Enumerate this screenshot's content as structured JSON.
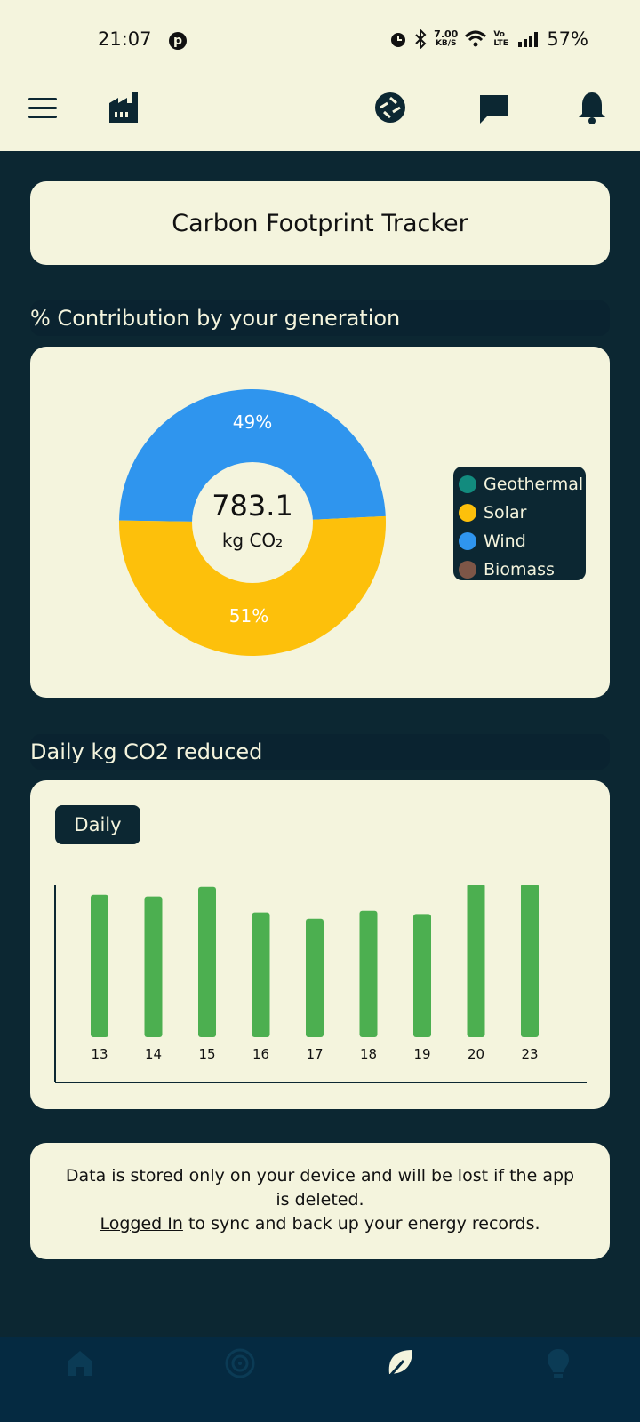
{
  "status_bar": {
    "time": "21:07",
    "pinterest_icon": "pinterest-icon",
    "speed_value": "7.00",
    "speed_unit": "KB/S",
    "volte": "Vo LTE",
    "battery": "57%"
  },
  "app_bar": {
    "icons": [
      "menu-icon",
      "factory-icon",
      "camera-shutter-icon",
      "chat-icon",
      "bell-icon"
    ]
  },
  "title": "Carbon Footprint Tracker",
  "contribution": {
    "heading": "% Contribution by your generation",
    "total_value": "783.1",
    "total_unit": "kg CO₂",
    "slice_labels": {
      "wind": "49%",
      "solar": "51%"
    },
    "legend": [
      {
        "label": "Geothermal",
        "color": "#128b7e"
      },
      {
        "label": "Solar",
        "color": "#fdc00b"
      },
      {
        "label": "Wind",
        "color": "#2f95ee"
      },
      {
        "label": "Biomass",
        "color": "#7d5647"
      }
    ]
  },
  "daily": {
    "heading": "Daily kg CO2 reduced",
    "toggle_label": "Daily"
  },
  "notice": {
    "text": "Data is stored only on your device and will be lost if the app is deleted.",
    "link_text": "Logged In",
    "link_suffix": " to sync and back up your energy records."
  },
  "bottom_nav": {
    "items": [
      "home-icon",
      "target-icon",
      "leaf-icon",
      "lightbulb-icon"
    ],
    "active": "leaf-icon"
  },
  "colors": {
    "background": "#0c2732",
    "card": "#f4f4dd",
    "bar": "#4caf50",
    "nav": "#052a41"
  },
  "chart_data": [
    {
      "type": "pie",
      "categories": [
        "Geothermal",
        "Solar",
        "Wind",
        "Biomass"
      ],
      "values": [
        0,
        51,
        49,
        0
      ],
      "center_value": "783.1",
      "center_unit": "kg CO₂"
    },
    {
      "type": "bar",
      "categories": [
        "13",
        "14",
        "15",
        "16",
        "17",
        "18",
        "19",
        "20",
        "23"
      ],
      "values": [
        0.89,
        0.88,
        0.94,
        0.78,
        0.74,
        0.79,
        0.77,
        0.96,
        0.96
      ],
      "value_units": "fraction of tallest bar (no y-axis scale shown)",
      "grid": false
    }
  ]
}
